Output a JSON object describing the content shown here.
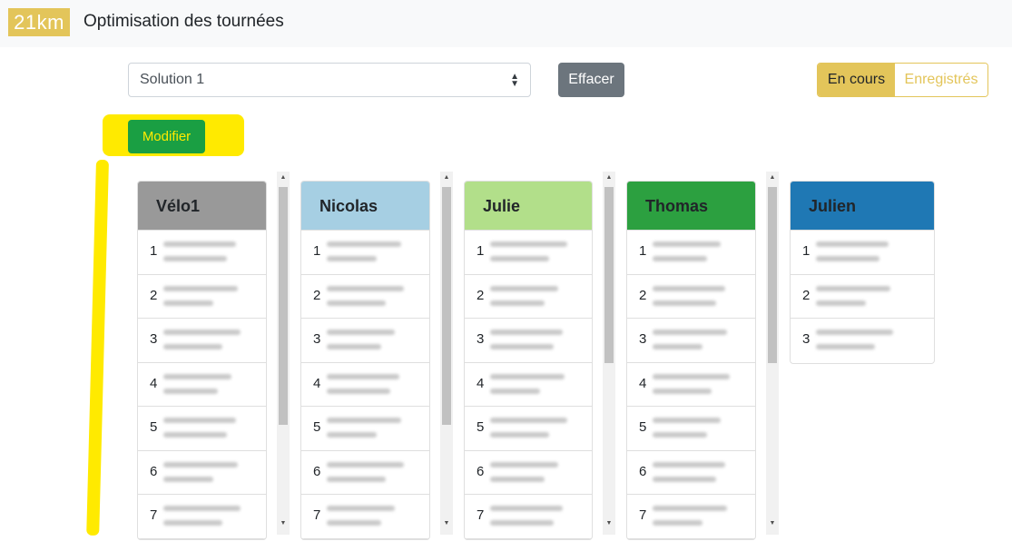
{
  "header": {
    "logo": "21km",
    "title": "Optimisation des tournées"
  },
  "toolbar": {
    "solution_value": "Solution 1",
    "clear_label": "Effacer",
    "toggle_active": "En cours",
    "toggle_inactive": "Enregistrés",
    "edit_label": "Modifier"
  },
  "colors": {
    "accent": "#e3c55a",
    "modifier": "#1a9f43",
    "highlight": "#ffea00"
  },
  "routes": [
    {
      "name": "Vélo1",
      "color": "#999999",
      "text_color": "#212529",
      "stops": [
        "1",
        "2",
        "3",
        "4",
        "5",
        "6",
        "7"
      ]
    },
    {
      "name": "Nicolas",
      "color": "#a6cfe3",
      "text_color": "#212529",
      "stops": [
        "1",
        "2",
        "3",
        "4",
        "5",
        "6",
        "7"
      ]
    },
    {
      "name": "Julie",
      "color": "#b2df8a",
      "text_color": "#212529",
      "stops": [
        "1",
        "2",
        "3",
        "4",
        "5",
        "6",
        "7"
      ]
    },
    {
      "name": "Thomas",
      "color": "#2ca040",
      "text_color": "#212529",
      "stops": [
        "1",
        "2",
        "3",
        "4",
        "5",
        "6",
        "7"
      ]
    },
    {
      "name": "Julien",
      "color": "#1f78b4",
      "text_color": "#212529",
      "stops": [
        "1",
        "2",
        "3"
      ]
    }
  ]
}
